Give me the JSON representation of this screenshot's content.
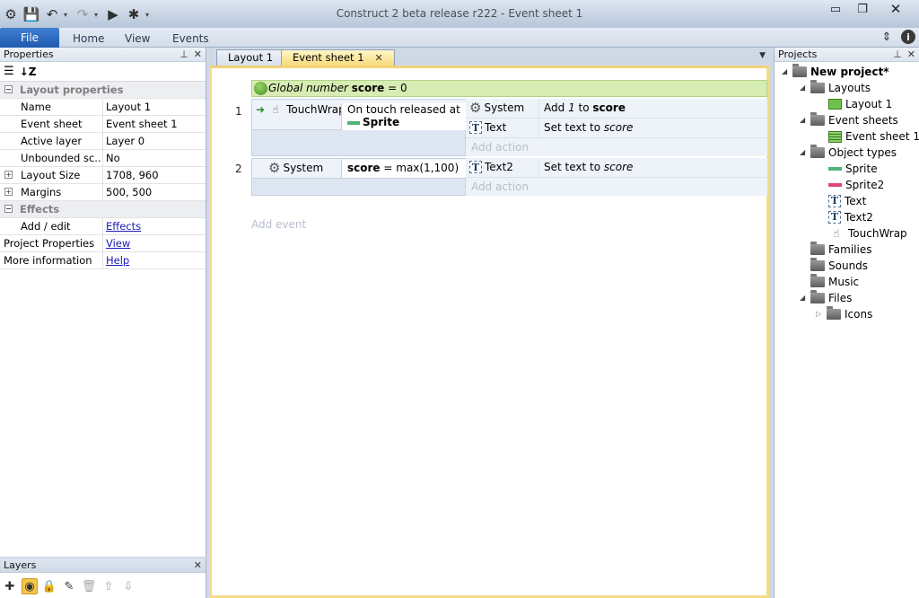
{
  "window": {
    "title": "Construct 2 beta release r222 - Event sheet 1"
  },
  "ribbon": {
    "tabs": [
      "File",
      "Home",
      "View",
      "Events"
    ]
  },
  "properties": {
    "title": "Properties",
    "category_layout": "Layout properties",
    "rows": [
      {
        "key": "Name",
        "value": "Layout 1"
      },
      {
        "key": "Event sheet",
        "value": "Event sheet 1"
      },
      {
        "key": "Active layer",
        "value": "Layer 0"
      },
      {
        "key": "Unbounded sc...",
        "value": "No"
      },
      {
        "key": "Layout Size",
        "value": "1708, 960"
      },
      {
        "key": "Margins",
        "value": "500, 500"
      }
    ],
    "category_effects": "Effects",
    "add_edit": {
      "key": "Add / edit",
      "value": "Effects"
    },
    "project_properties": {
      "key": "Project Properties",
      "value": "View"
    },
    "more_information": {
      "key": "More information",
      "value": "Help"
    }
  },
  "layers": {
    "title": "Layers"
  },
  "editor": {
    "tabs": [
      "Layout 1",
      "Event sheet 1"
    ],
    "global_var": {
      "prefix": "Global number",
      "name": "score",
      "suffix": "= 0"
    },
    "events": [
      {
        "number": "1",
        "condition_object": "TouchWrap",
        "condition_line1": "On touch released at",
        "condition_line2": "Sprite",
        "actions": [
          {
            "object": "System",
            "pre": "Add",
            "italic": "1",
            "mid": "to",
            "bold": "score"
          },
          {
            "object": "Text",
            "pre": "Set text to",
            "italic": "score"
          }
        ],
        "add_action": "Add action"
      },
      {
        "number": "2",
        "condition_object": "System",
        "condition_bold": "score",
        "condition_rest": "= max(1,100)",
        "actions": [
          {
            "object": "Text2",
            "pre": "Set text to",
            "italic": "score"
          }
        ],
        "add_action": "Add action"
      }
    ],
    "add_event": "Add event"
  },
  "projects": {
    "title": "Projects",
    "root": "New project*",
    "layouts": "Layouts",
    "layout1": "Layout 1",
    "event_sheets": "Event sheets",
    "event_sheet1": "Event sheet 1",
    "object_types": "Object types",
    "objects": [
      "Sprite",
      "Sprite2",
      "Text",
      "Text2",
      "TouchWrap"
    ],
    "families": "Families",
    "sounds": "Sounds",
    "music": "Music",
    "files": "Files",
    "icons": "Icons"
  },
  "colors": {
    "file_tab": "#2a67bf",
    "global_var_bg": "#d7ecb2",
    "active_tab": "#f7d97a",
    "sprite_icon": "#4fb478",
    "sprite2_icon": "#e0457a"
  }
}
